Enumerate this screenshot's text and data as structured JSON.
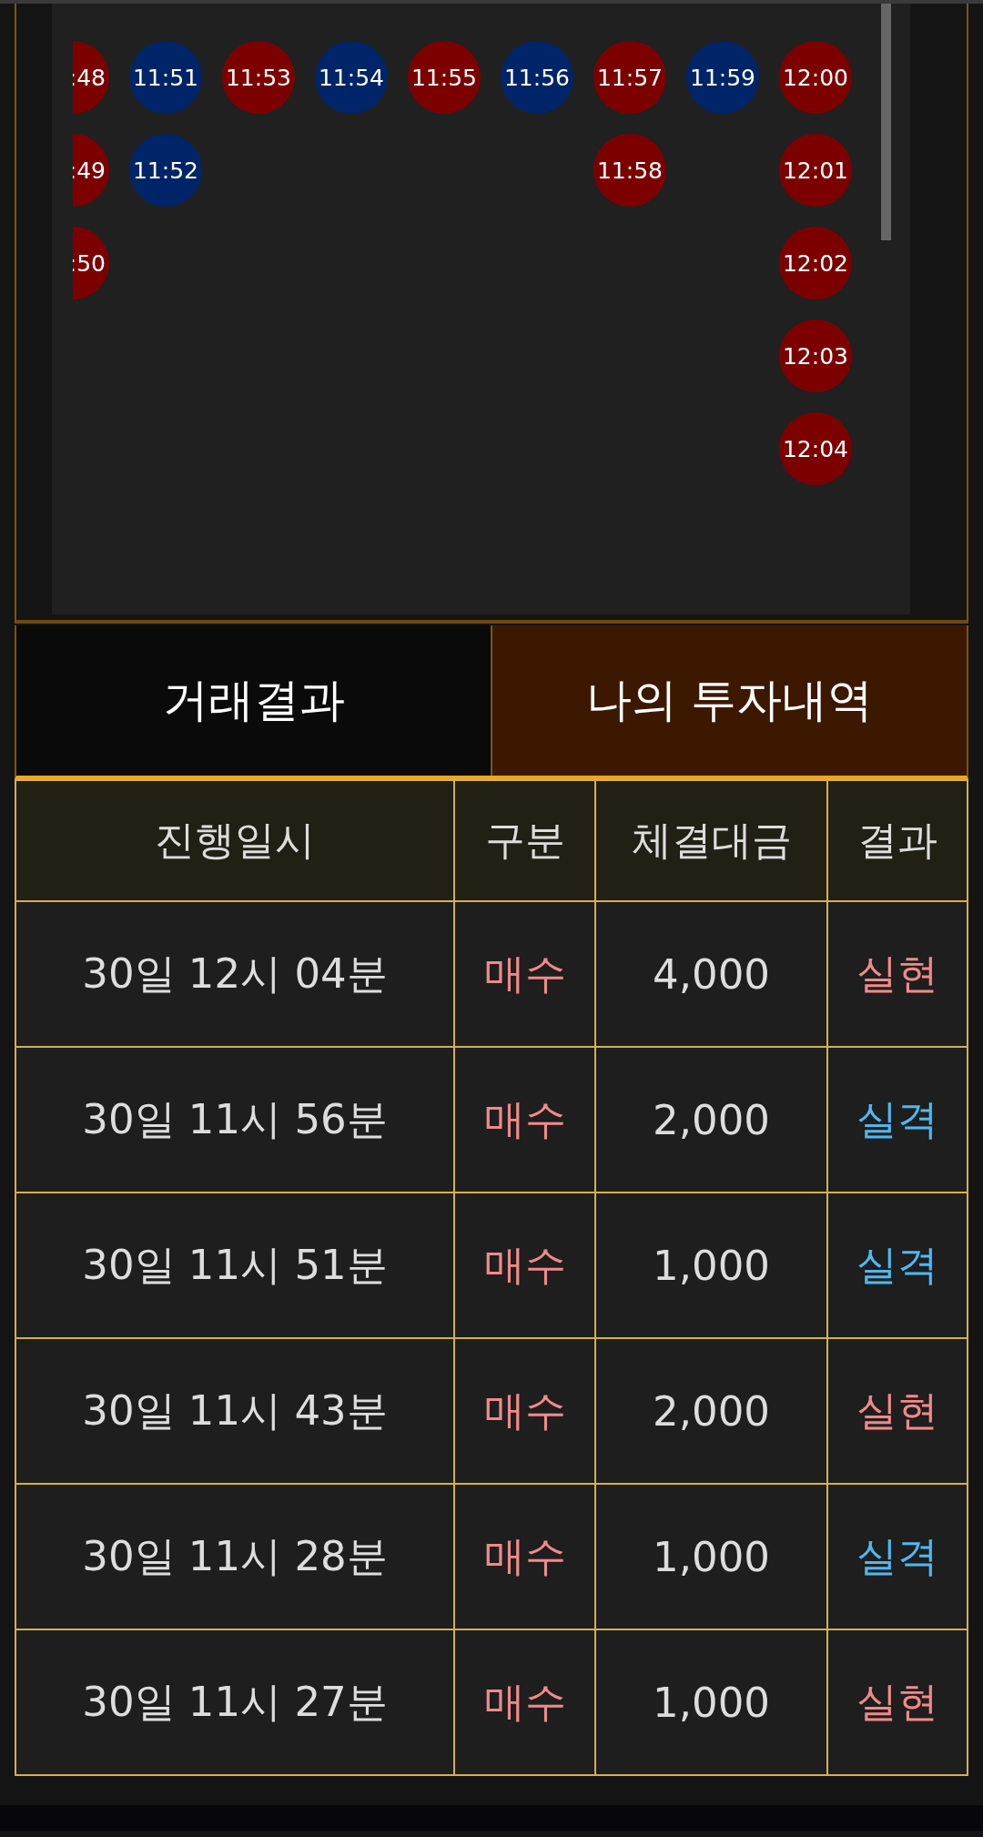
{
  "timeline": {
    "columns": [
      {
        "kind": "partial",
        "beads": [
          {
            "text": ":48",
            "color": "#7d0000"
          },
          {
            "text": ":49",
            "color": "#7d0000"
          },
          {
            "text": ":50",
            "color": "#7d0000"
          }
        ]
      },
      {
        "beads": [
          {
            "text": "11:51",
            "color": "#002468"
          },
          {
            "text": "11:52",
            "color": "#002468"
          }
        ]
      },
      {
        "beads": [
          {
            "text": "11:53",
            "color": "#7d0000"
          }
        ]
      },
      {
        "beads": [
          {
            "text": "11:54",
            "color": "#002468"
          }
        ]
      },
      {
        "beads": [
          {
            "text": "11:55",
            "color": "#7d0000"
          }
        ]
      },
      {
        "beads": [
          {
            "text": "11:56",
            "color": "#002468"
          }
        ]
      },
      {
        "beads": [
          {
            "text": "11:57",
            "color": "#7d0000"
          },
          {
            "text": "11:58",
            "color": "#7d0000"
          }
        ]
      },
      {
        "beads": [
          {
            "text": "11:59",
            "color": "#002468"
          }
        ]
      },
      {
        "beads": [
          {
            "text": "12:00",
            "color": "#7d0000"
          },
          {
            "text": "12:01",
            "color": "#7d0000"
          },
          {
            "text": "12:02",
            "color": "#7d0000"
          },
          {
            "text": "12:03",
            "color": "#7d0000"
          },
          {
            "text": "12:04",
            "color": "#7d0000"
          }
        ]
      }
    ]
  },
  "tabs": [
    {
      "label": "거래결과",
      "selected": false
    },
    {
      "label": "나의 투자내역",
      "selected": true
    }
  ],
  "table": {
    "columns": [
      "진행일시",
      "구분",
      "체결대금",
      "결과"
    ],
    "rows": [
      {
        "time": "30일 12시 04분",
        "side": "매수",
        "amount": "4,000",
        "result": "실현",
        "kind": "realized"
      },
      {
        "time": "30일 11시 56분",
        "side": "매수",
        "amount": "2,000",
        "result": "실격",
        "kind": "failed"
      },
      {
        "time": "30일 11시 51분",
        "side": "매수",
        "amount": "1,000",
        "result": "실격",
        "kind": "failed"
      },
      {
        "time": "30일 11시 43분",
        "side": "매수",
        "amount": "2,000",
        "result": "실현",
        "kind": "realized"
      },
      {
        "time": "30일 11시 28분",
        "side": "매수",
        "amount": "1,000",
        "result": "실격",
        "kind": "failed"
      },
      {
        "time": "30일 11시 27분",
        "side": "매수",
        "amount": "1,000",
        "result": "실현",
        "kind": "realized"
      }
    ]
  }
}
